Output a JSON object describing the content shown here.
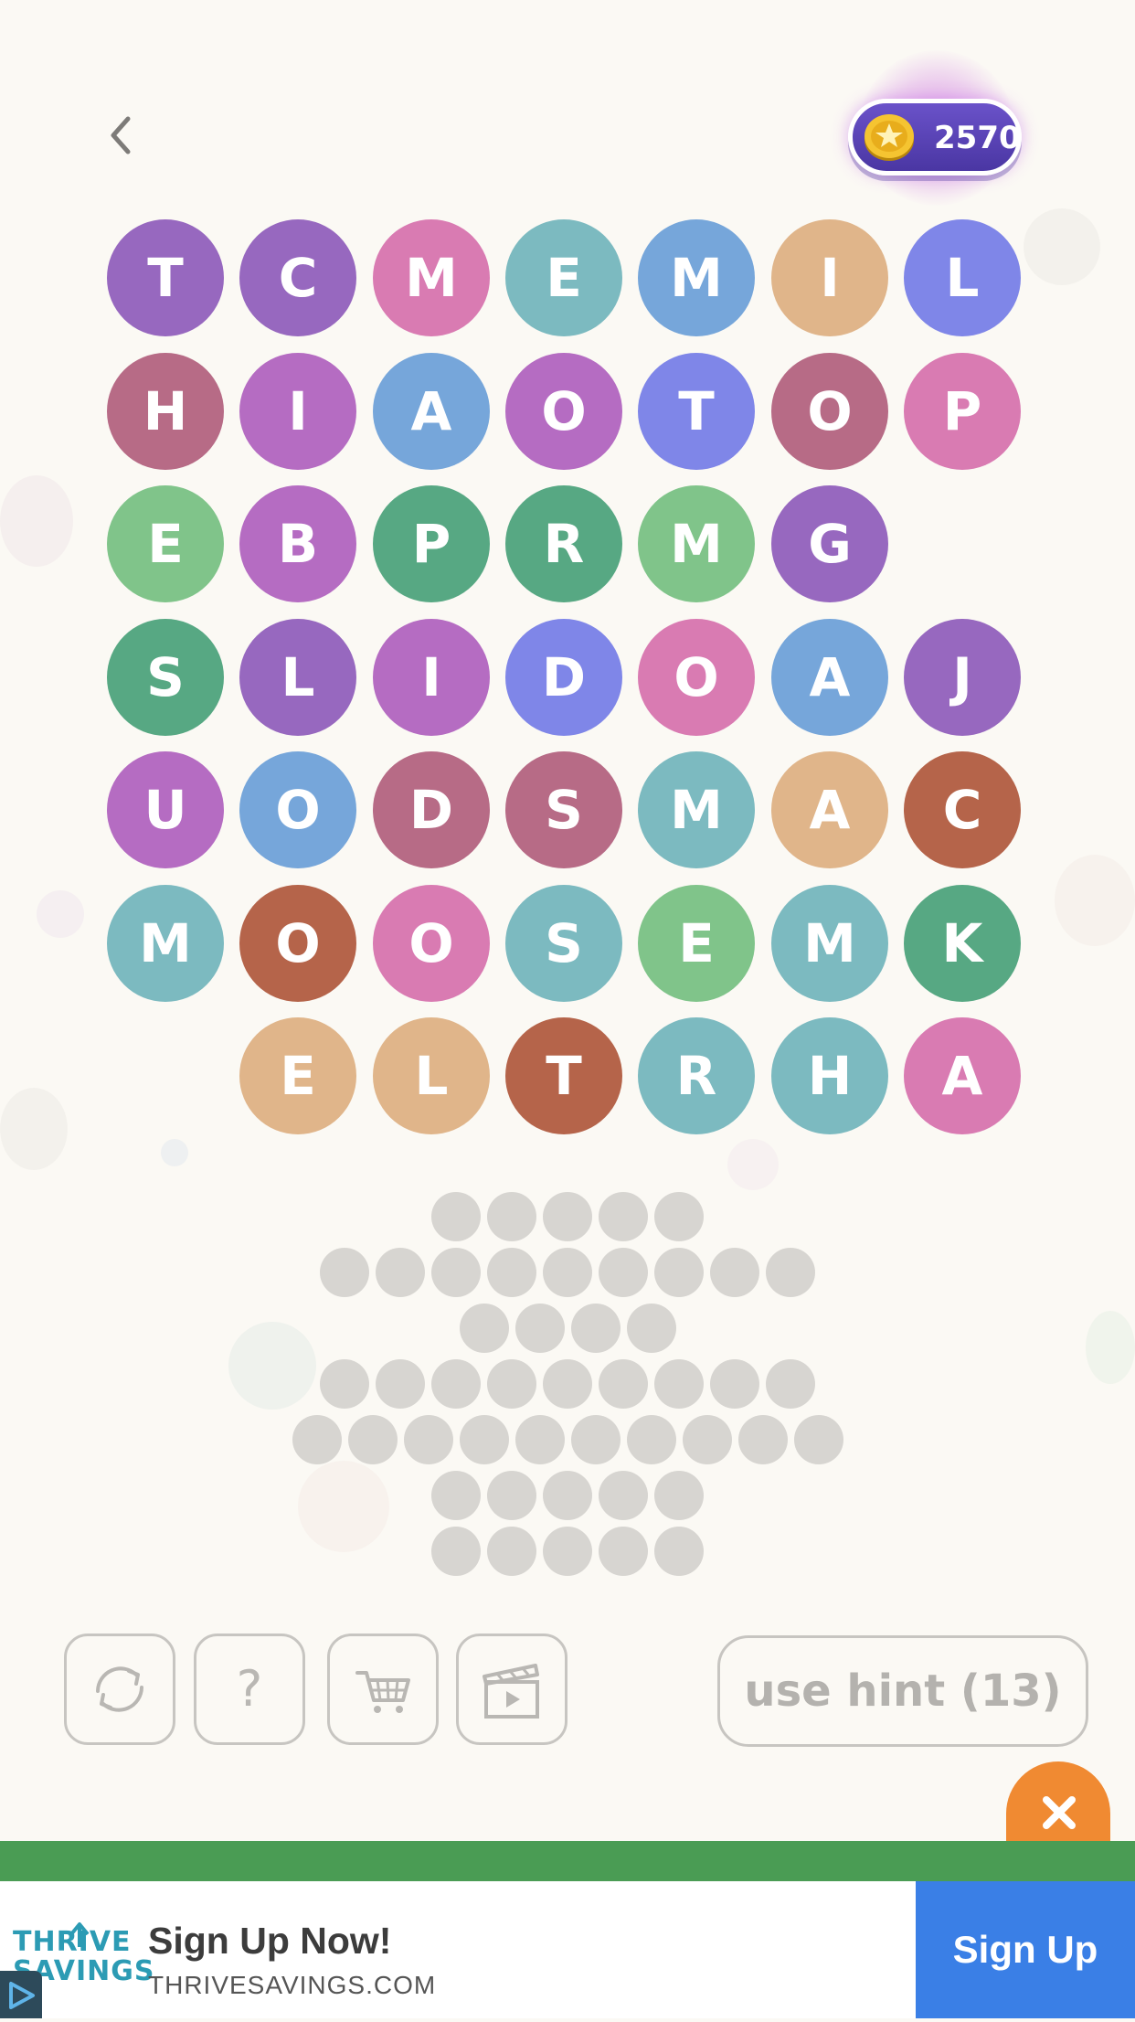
{
  "header": {
    "back_icon": "chevron-left-icon",
    "coins": "2570",
    "coin_icon": "star-coin-icon"
  },
  "board": {
    "rows": [
      [
        "T",
        "C",
        "M",
        "E",
        "M",
        "I",
        "L"
      ],
      [
        "H",
        "I",
        "A",
        "O",
        "T",
        "O",
        "P"
      ],
      [
        "E",
        "B",
        "P",
        "R",
        "M",
        "G",
        ""
      ],
      [
        "S",
        "L",
        "I",
        "D",
        "O",
        "A",
        "J"
      ],
      [
        "U",
        "O",
        "D",
        "S",
        "M",
        "A",
        "C"
      ],
      [
        "M",
        "O",
        "O",
        "S",
        "E",
        "M",
        "K"
      ],
      [
        "",
        "E",
        "L",
        "T",
        "R",
        "H",
        "A"
      ]
    ],
    "colors": [
      [
        "#9768bf",
        "#9768bf",
        "#d97bb2",
        "#7cbac0",
        "#76a6da",
        "#e0b58a",
        "#7f86e8"
      ],
      [
        "#b76b86",
        "#b56cc2",
        "#76a6da",
        "#b56cc2",
        "#7f86e8",
        "#b76b86",
        "#d97bb2"
      ],
      [
        "#80c48a",
        "#b56cc2",
        "#57a883",
        "#57a883",
        "#80c48a",
        "#9768bf",
        ""
      ],
      [
        "#57a883",
        "#9768bf",
        "#b56cc2",
        "#7f86e8",
        "#d97bb2",
        "#76a6da",
        "#9768bf"
      ],
      [
        "#b56cc2",
        "#76a6da",
        "#b76b86",
        "#b76b86",
        "#7cbac0",
        "#e0b58a",
        "#b5644a"
      ],
      [
        "#7cbac0",
        "#b5644a",
        "#d97bb2",
        "#7cbac0",
        "#80c48a",
        "#7cbac0",
        "#57a883"
      ],
      [
        "",
        "#e0b58a",
        "#e0b58a",
        "#b5644a",
        "#7cbac0",
        "#7cbac0",
        "#d97bb2"
      ]
    ]
  },
  "answer_slots": {
    "row_lengths": [
      5,
      9,
      4,
      9,
      10,
      5,
      5
    ]
  },
  "toolbar": {
    "shuffle_icon": "shuffle-icon",
    "help_glyph": "?",
    "shop_icon": "shopping-cart-icon",
    "video_icon": "video-clapperboard-icon",
    "hint_label": "use hint (13)"
  },
  "ad": {
    "close_icon": "close-icon",
    "logo_line1": "THRIVE",
    "logo_line2": "SAVINGS",
    "title": "Sign Up Now!",
    "url": "THRIVESAVINGS.COM",
    "cta": "Sign Up",
    "adchoices_icon": "adchoices-icon"
  },
  "colors": {
    "background": "#fbf9f4",
    "coin_pill": "#5a44b6",
    "ad_close": "#f08a32",
    "ad_bar": "#4a9c54",
    "ad_cta": "#3a7fe6",
    "slot": "#d7d5d1"
  }
}
